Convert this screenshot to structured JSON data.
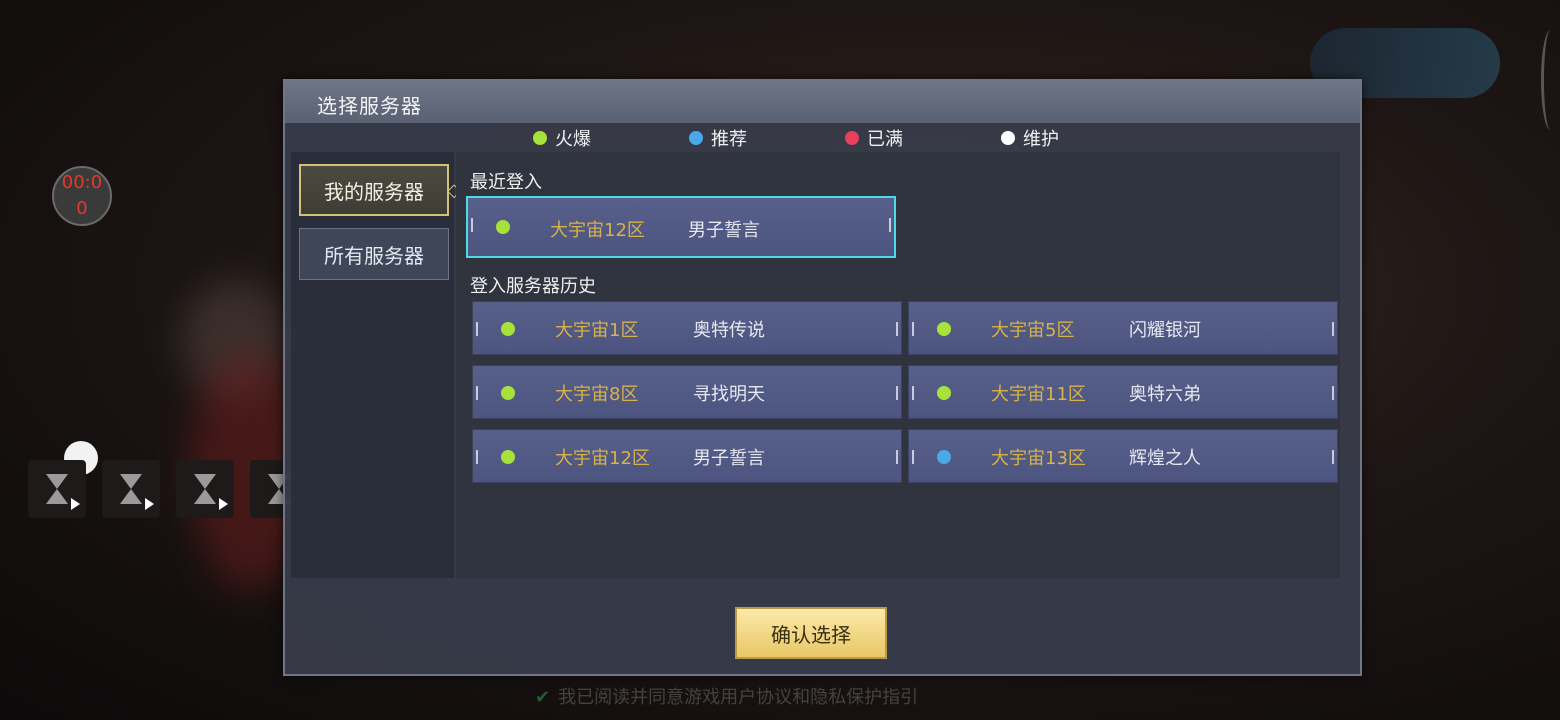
{
  "hud": {
    "timer": "00:00",
    "slot_icon": "hourglass-icon"
  },
  "background": {
    "footer_text": "我已阅读并同意游戏用户协议和隐私保护指引"
  },
  "dialog": {
    "title": "选择服务器",
    "legend": [
      {
        "label": "火爆",
        "color": "#a6e23a"
      },
      {
        "label": "推荐",
        "color": "#4aa8e8"
      },
      {
        "label": "已满",
        "color": "#e8405a"
      },
      {
        "label": "维护",
        "color": "#ffffff"
      }
    ],
    "tabs": {
      "mine": "我的服务器",
      "all": "所有服务器"
    },
    "recent": {
      "title": "最近登入",
      "server": {
        "zone": "大宇宙12区",
        "name": "男子誓言",
        "status": "火爆"
      }
    },
    "history": {
      "title": "登入服务器历史",
      "servers": [
        {
          "zone": "大宇宙1区",
          "name": "奥特传说",
          "status": "火爆"
        },
        {
          "zone": "大宇宙5区",
          "name": "闪耀银河",
          "status": "火爆"
        },
        {
          "zone": "大宇宙8区",
          "name": "寻找明天",
          "status": "火爆"
        },
        {
          "zone": "大宇宙11区",
          "name": "奥特六弟",
          "status": "火爆"
        },
        {
          "zone": "大宇宙12区",
          "name": "男子誓言",
          "status": "火爆"
        },
        {
          "zone": "大宇宙13区",
          "name": "辉煌之人",
          "status": "推荐"
        }
      ]
    },
    "confirm_label": "确认选择"
  }
}
